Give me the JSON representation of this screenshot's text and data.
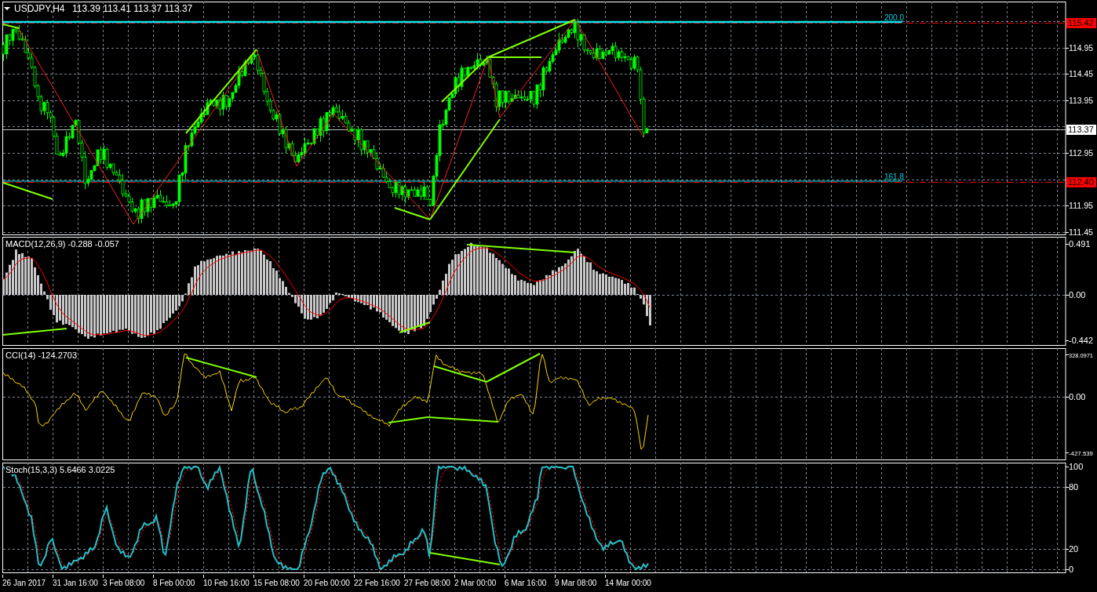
{
  "header": {
    "symbol": "USDJPY,H4",
    "quotes": "113.39 113.41 113.37 113.37"
  },
  "main_chart": {
    "price_labels": [
      "114.95",
      "114.45",
      "113.95",
      "112.95",
      "111.95",
      "111.45"
    ],
    "level_tags": [
      {
        "text": "115.42",
        "kind": "level"
      },
      {
        "text": "113.37",
        "kind": "current"
      },
      {
        "text": "112.40",
        "kind": "level"
      }
    ],
    "fibo_labels": [
      "200.0",
      "161.8"
    ]
  },
  "indicators": [
    {
      "kind": "macd",
      "label": "MACD(12,26,9) -0.288 -0.057",
      "axis_labels": [
        "0.491",
        "0.00",
        "-0.442"
      ]
    },
    {
      "kind": "cci",
      "label": "CCI(14) -124.2703",
      "axis_labels": [
        "328.0971",
        "0.00",
        "-427.539"
      ]
    },
    {
      "kind": "stoch",
      "label": "Stoch(15,3,3) 5.6466 3.0225",
      "axis_labels": [
        "100",
        "80",
        "20",
        "0"
      ]
    }
  ],
  "time_axis": [
    "26 Jan 2017",
    "31 Jan 16:00",
    "3 Feb 08:00",
    "8 Feb 00:00",
    "10 Feb 16:00",
    "15 Feb 08:00",
    "20 Feb 00:00",
    "22 Feb 16:00",
    "27 Feb 08:00",
    "2 Mar 00:00",
    "6 Mar 16:00",
    "9 Mar 08:00",
    "14 Mar 00:00"
  ]
}
